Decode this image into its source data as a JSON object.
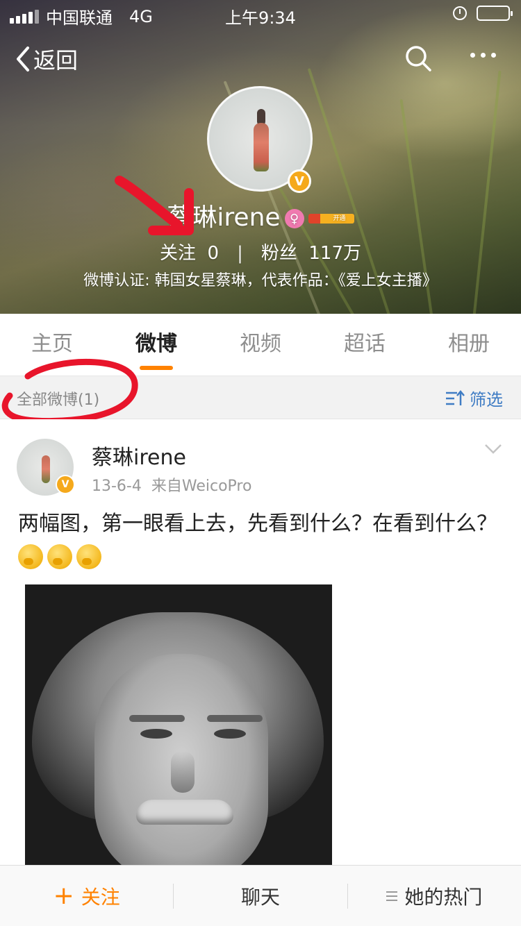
{
  "status_bar": {
    "carrier": "中国联通",
    "network": "4G",
    "time": "上午9:34",
    "battery_level": 0.9
  },
  "nav": {
    "back_label": "返回",
    "back_icon": "chevron-left-icon",
    "search_icon": "search-icon",
    "more_icon": "more-dots-icon"
  },
  "profile": {
    "name": "蔡琳irene",
    "gender_symbol": "♀",
    "verified_badge": "V",
    "vip_text": "开通",
    "following_label": "关注",
    "following_count": "0",
    "followers_label": "粉丝",
    "followers_count": "117万",
    "separator": "|",
    "verification": "微博认证: 韩国女星蔡琳，代表作品：《爱上女主播》"
  },
  "tabs": [
    {
      "label": "主页",
      "active": false
    },
    {
      "label": "微博",
      "active": true
    },
    {
      "label": "视频",
      "active": false
    },
    {
      "label": "超话",
      "active": false
    },
    {
      "label": "相册",
      "active": false
    }
  ],
  "filter_bar": {
    "count_label": "全部微博(1)",
    "filter_label": "筛选"
  },
  "post": {
    "author": "蔡琳irene",
    "verified_badge": "V",
    "date": "13-6-4",
    "source": "来自WeicoPro",
    "text": "两幅图，第一眼看上去，先看到什么？在看到什么？"
  },
  "bottom_bar": {
    "follow_label": "关注",
    "follow_plus": "+",
    "chat_label": "聊天",
    "hot_label": "她的热门"
  },
  "colors": {
    "accent": "#ff8200",
    "filter_blue": "#3f7cc4",
    "verified_gold": "#f5a91c",
    "annotation_red": "#e8152b"
  }
}
